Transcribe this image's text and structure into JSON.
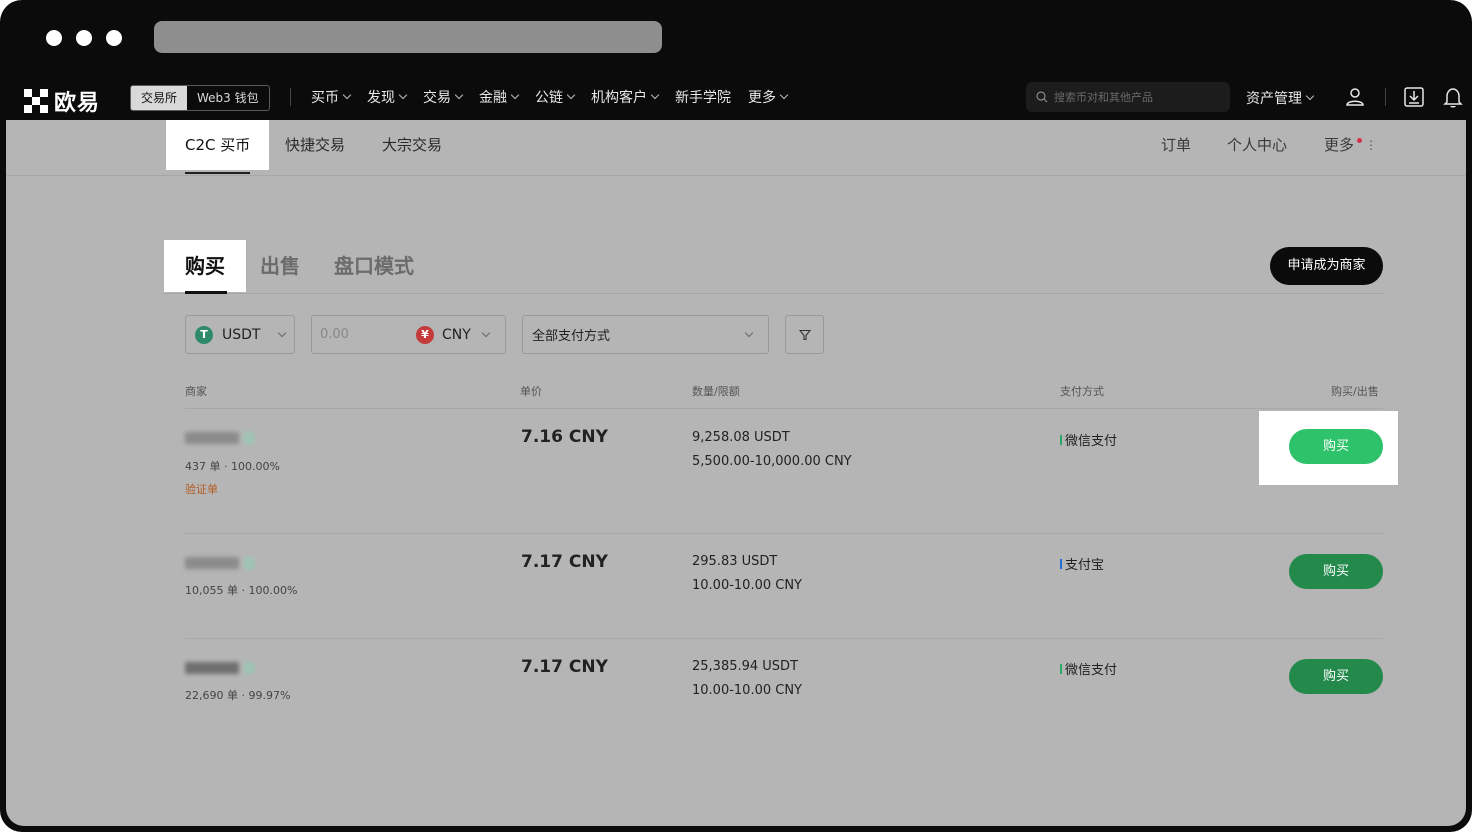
{
  "browser": {
    "window_dots": [
      "dot",
      "dot",
      "dot"
    ]
  },
  "topnav": {
    "logo_text": "欧易",
    "switch": [
      "交易所",
      "Web3 钱包"
    ],
    "menu": [
      {
        "label": "买币",
        "has_chevron": true
      },
      {
        "label": "发现",
        "has_chevron": true
      },
      {
        "label": "交易",
        "has_chevron": true
      },
      {
        "label": "金融",
        "has_chevron": true
      },
      {
        "label": "公链",
        "has_chevron": true
      },
      {
        "label": "机构客户",
        "has_chevron": true
      },
      {
        "label": "新手学院",
        "has_chevron": false
      },
      {
        "label": "更多",
        "has_chevron": true
      }
    ],
    "search_placeholder": "搜索币对和其他产品",
    "asset_label": "资产管理",
    "icons": [
      "user-icon",
      "download-icon",
      "bell-icon"
    ]
  },
  "subnav": {
    "tabs": [
      "C2C 买币",
      "快捷交易",
      "大宗交易"
    ],
    "active_tab": "C2C 买币",
    "right_links": [
      "订单",
      "个人中心",
      "更多"
    ]
  },
  "trade": {
    "tabs": [
      "购买",
      "出售",
      "盘口模式"
    ],
    "active_tab": "购买",
    "merchant_button": "申请成为商家"
  },
  "filters": {
    "coin": "USDT",
    "amount_placeholder": "0.00",
    "fiat": "CNY",
    "fiat_symbol": "¥",
    "payment_method": "全部支付方式",
    "filter_icon": "filter-icon"
  },
  "table": {
    "headers": [
      "商家",
      "单价",
      "数量/限额",
      "支付方式",
      "购买/出售"
    ],
    "rows": [
      {
        "orders": "437 单",
        "completion": "100.00%",
        "verify_tag": "验证单",
        "price": "7.16 CNY",
        "quantity": "9,258.08 USDT",
        "limit": "5,500.00-10,000.00 CNY",
        "payment": "微信支付",
        "payment_color": "#2aa866",
        "action": "购买"
      },
      {
        "orders": "10,055 单",
        "completion": "100.00%",
        "verify_tag": "",
        "price": "7.17 CNY",
        "quantity": "295.83 USDT",
        "limit": "10.00-10.00 CNY",
        "payment": "支付宝",
        "payment_color": "#1e6fd9",
        "action": "购买"
      },
      {
        "orders": "22,690 单",
        "completion": "99.97%",
        "verify_tag": "",
        "price": "7.17 CNY",
        "quantity": "25,385.94 USDT",
        "limit": "10.00-10.00 CNY",
        "payment": "微信支付",
        "payment_color": "#2aa866",
        "action": "购买"
      }
    ]
  },
  "colors": {
    "buy_green_highlight": "#2ec26a",
    "buy_green_dim": "#238a4c",
    "usdt_green": "#2f8a6b",
    "cny_red": "#c53a3a",
    "overlay_gray": "#b5b5b5"
  }
}
